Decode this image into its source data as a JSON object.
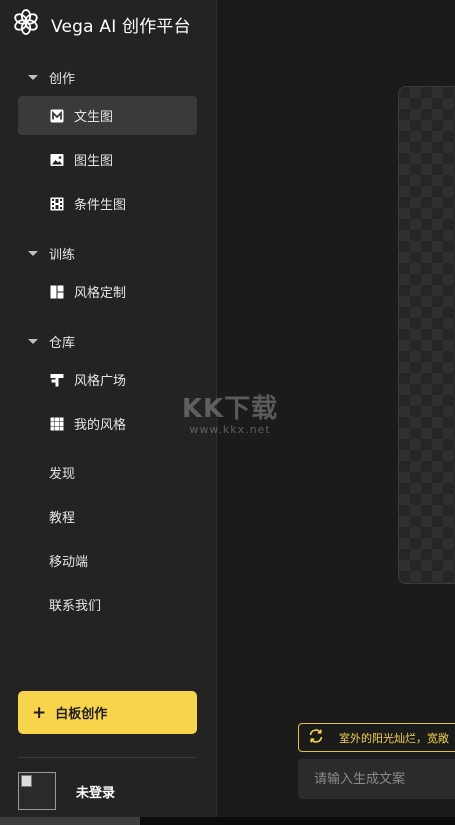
{
  "app": {
    "title": "Vega AI 创作平台"
  },
  "sidebar": {
    "sections": [
      {
        "label": "创作",
        "items": [
          {
            "label": "文生图",
            "icon": "text-to-image-icon",
            "active": true
          },
          {
            "label": "图生图",
            "icon": "image-icon"
          },
          {
            "label": "条件生图",
            "icon": "grid-film-icon"
          }
        ]
      },
      {
        "label": "训练",
        "items": [
          {
            "label": "风格定制",
            "icon": "layout-icon"
          }
        ]
      },
      {
        "label": "仓库",
        "items": [
          {
            "label": "风格广场",
            "icon": "signpost-icon"
          },
          {
            "label": "我的风格",
            "icon": "grid-icon"
          }
        ]
      }
    ],
    "links": [
      "发现",
      "教程",
      "移动端",
      "联系我们"
    ],
    "whiteboard_button": {
      "icon": "+",
      "label": "白板创作"
    },
    "user": {
      "login_label": "未登录"
    }
  },
  "main": {
    "suggestion_text": "室外的阳光灿烂，宽敞",
    "prompt_placeholder": "请输入生成文案"
  },
  "watermark": {
    "line1": "KK下载",
    "line2": "www.kkx.net"
  },
  "colors": {
    "accent": "#f8d44a",
    "sidebar_bg": "#232323",
    "active_item_bg": "#3a3a3a",
    "main_bg": "#1b1b1b"
  }
}
